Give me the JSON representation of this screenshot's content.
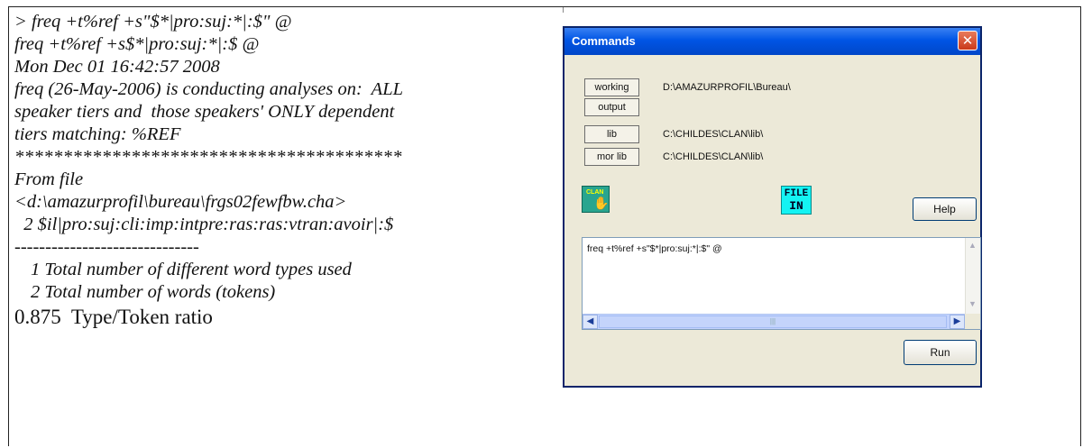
{
  "transcript": {
    "lines": [
      "> freq +t%ref +s\"$*|pro:suj:*|:$\" @",
      "freq +t%ref +s$*|pro:suj:*|:$ @",
      "Mon Dec 01 16:42:57 2008",
      "freq (26-May-2006) is conducting analyses on:  ALL",
      "speaker tiers and  those speakers' ONLY dependent",
      "tiers matching: %REF"
    ],
    "stars": "****************************************",
    "from_file_label": "From file",
    "file_path": "<d:\\amazurprofil\\bureau\\frgs02fewfbw.cha>",
    "result_line": "  2 $il|pro:suj:cli:imp:intpre:ras:ras:vtran:avoir|:$",
    "dashes": "------------------------------",
    "totals": [
      "1 Total number of different word types used",
      "2 Total number of words (tokens)"
    ],
    "ratio": "0.875  Type/Token ratio"
  },
  "dialog": {
    "title": "Commands",
    "close_glyph": "✕",
    "buttons": {
      "working": "working",
      "output": "output",
      "lib": "lib",
      "mor_lib": "mor lib",
      "help": "Help",
      "run": "Run"
    },
    "paths": {
      "working": "D:\\AMAZURPROFIL\\Bureau\\",
      "lib": "C:\\CHILDES\\CLAN\\lib\\",
      "mor_lib": "C:\\CHILDES\\CLAN\\lib\\"
    },
    "icons": {
      "clan": "CLAN",
      "file_in_line1": "FILE",
      "file_in_line2": "IN"
    },
    "command_text": "freq +t%ref +s\"$*|pro:suj:*|:$\" @",
    "colors": {
      "titlebar": "#0055e5",
      "close": "#c9391b",
      "body": "#ece9d8",
      "file_in_icon": "#14f3f3",
      "clan_icon": "#29a58f"
    }
  }
}
